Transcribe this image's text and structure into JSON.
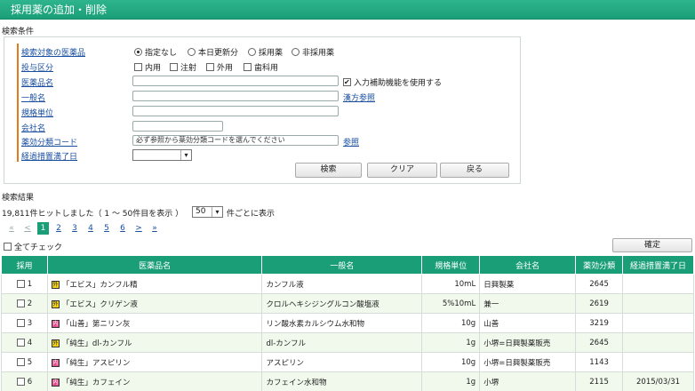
{
  "title": "採用薬の追加・削除",
  "search": {
    "section_label": "検索条件",
    "fields": {
      "target": "検索対象の医薬品",
      "route": "投与区分",
      "drug_name": "医薬品名",
      "generic": "一般名",
      "spec": "規格単位",
      "company": "会社名",
      "efficacy": "薬効分類コード",
      "transition": "経過措置満了日"
    },
    "target_options": [
      "指定なし",
      "本日更新分",
      "採用薬",
      "非採用薬"
    ],
    "target_selected": 0,
    "route_options": [
      "内用",
      "注射",
      "外用",
      "歯科用"
    ],
    "assist_label": "入力補助機能を使用する",
    "kampo_link": "漢方参照",
    "efficacy_placeholder": "必ず参照から薬効分類コードを選んでください",
    "ref_link": "参照",
    "search_button": "検索",
    "clear_button": "クリア",
    "back_button": "戻る"
  },
  "results": {
    "section_label": "検索結果",
    "hits_text": "19,811件ヒットしました（ 1 〜 50件目を表示 ）",
    "per_page": "50",
    "per_page_suffix": "件ごとに表示",
    "pager": [
      "«",
      "<",
      "1",
      "2",
      "3",
      "4",
      "5",
      "6",
      ">",
      "»"
    ],
    "check_all": "全てチェック",
    "confirm_button": "確定",
    "columns": [
      "採用",
      "医薬品名",
      "一般名",
      "規格単位",
      "会社名",
      "薬効分類",
      "経過措置満了日"
    ],
    "rows": [
      {
        "no": "1",
        "badge": "yellow",
        "badge_text": "外",
        "name": "「エビス」カンフル精",
        "generic": "カンフル液",
        "spec": "10mL",
        "company": "日興製薬",
        "code": "2645",
        "date": ""
      },
      {
        "no": "2",
        "badge": "yellow",
        "badge_text": "外",
        "name": "「エビス」クリゲン液",
        "generic": "クロルヘキシジングルコン酸塩液",
        "spec": "5%10mL",
        "company": "兼一",
        "code": "2619",
        "date": ""
      },
      {
        "no": "3",
        "badge": "pink",
        "badge_text": "内",
        "name": "「山善」第ニリン灰",
        "generic": "リン酸水素カルシウム水和物",
        "spec": "10g",
        "company": "山善",
        "code": "3219",
        "date": ""
      },
      {
        "no": "4",
        "badge": "yellow",
        "badge_text": "外",
        "name": "「純生」dl-カンフル",
        "generic": "dl-カンフル",
        "spec": "1g",
        "company": "小堺=日興製薬販売",
        "code": "2645",
        "date": ""
      },
      {
        "no": "5",
        "badge": "pink",
        "badge_text": "内",
        "name": "「純生」アスピリン",
        "generic": "アスピリン",
        "spec": "10g",
        "company": "小堺=日興製薬販売",
        "code": "1143",
        "date": ""
      },
      {
        "no": "6",
        "badge": "pink",
        "badge_text": "内",
        "name": "「純生」カフェイン",
        "generic": "カフェイン水和物",
        "spec": "1g",
        "company": "小堺",
        "code": "2115",
        "date": "2015/03/31"
      }
    ]
  },
  "colors": {
    "accent": "#1a9e78",
    "link": "#1a4fa0",
    "marker": "#e07a1e"
  }
}
